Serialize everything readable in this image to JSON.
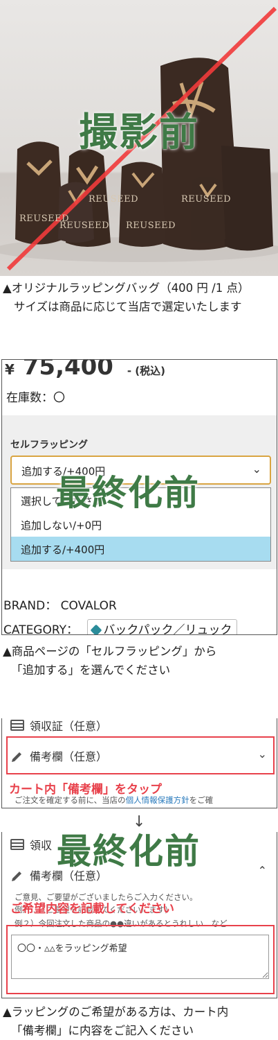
{
  "section1": {
    "overlay_label": "撮影前",
    "brand_tags": [
      "REUSEED",
      "REUSEED",
      "REUSEED",
      "REUSEED",
      "REUSEED"
    ],
    "caption_line1": "▲オリジナルラッピングバッグ（400 円 /1 点）",
    "caption_line2": "サイズは商品に応じて当店で選定いたします"
  },
  "section2": {
    "yen_symbol": "¥",
    "price": "75,400",
    "tax_label": "- (税込)",
    "stock": "在庫数：〇",
    "wrapping_title": "セルフラッピング",
    "select_value": "追加する/+400円",
    "options": [
      "選択してください",
      "追加しない/+0円",
      "追加する/+400円"
    ],
    "overlay_label": "最終化前",
    "brand_label": "BRAND：",
    "brand_value": "COVALOR",
    "category_label": "CATEGORY：",
    "category_value": "バックパック／リュック",
    "caption_line1": "▲商品ページの「セルフラッピング」から",
    "caption_line2": "「追加する」を選んでください"
  },
  "section3": {
    "receipt_label": "領収証（任意）",
    "memo_label": "備考欄（任意）",
    "tap_note": "カート内「備考欄」をタップ",
    "privacy_text_pre": "ご注文を確定する前に、当店の",
    "privacy_link": "個人情報保護方針",
    "privacy_text_post": "をご確",
    "arrow": "↓",
    "overlay_label": "最終化前",
    "receipt_label_2": "領収",
    "memo_label_2": "備考欄（任意）",
    "instruction": "ご意見、ご要望がございましたらご入力ください。",
    "example1": "例）...（ご要望を記載してください）ます)",
    "example2": "例２）今回注文した商品の●●違いがあるとうれしい　など",
    "write_note": "ご希望内容を記載してください",
    "memo_value": "〇〇・△△をラッピング希望",
    "caption_line1": "▲ラッピングのご希望がある方は、カート内",
    "caption_line2": "「備考欄」に内容をご記入ください"
  }
}
